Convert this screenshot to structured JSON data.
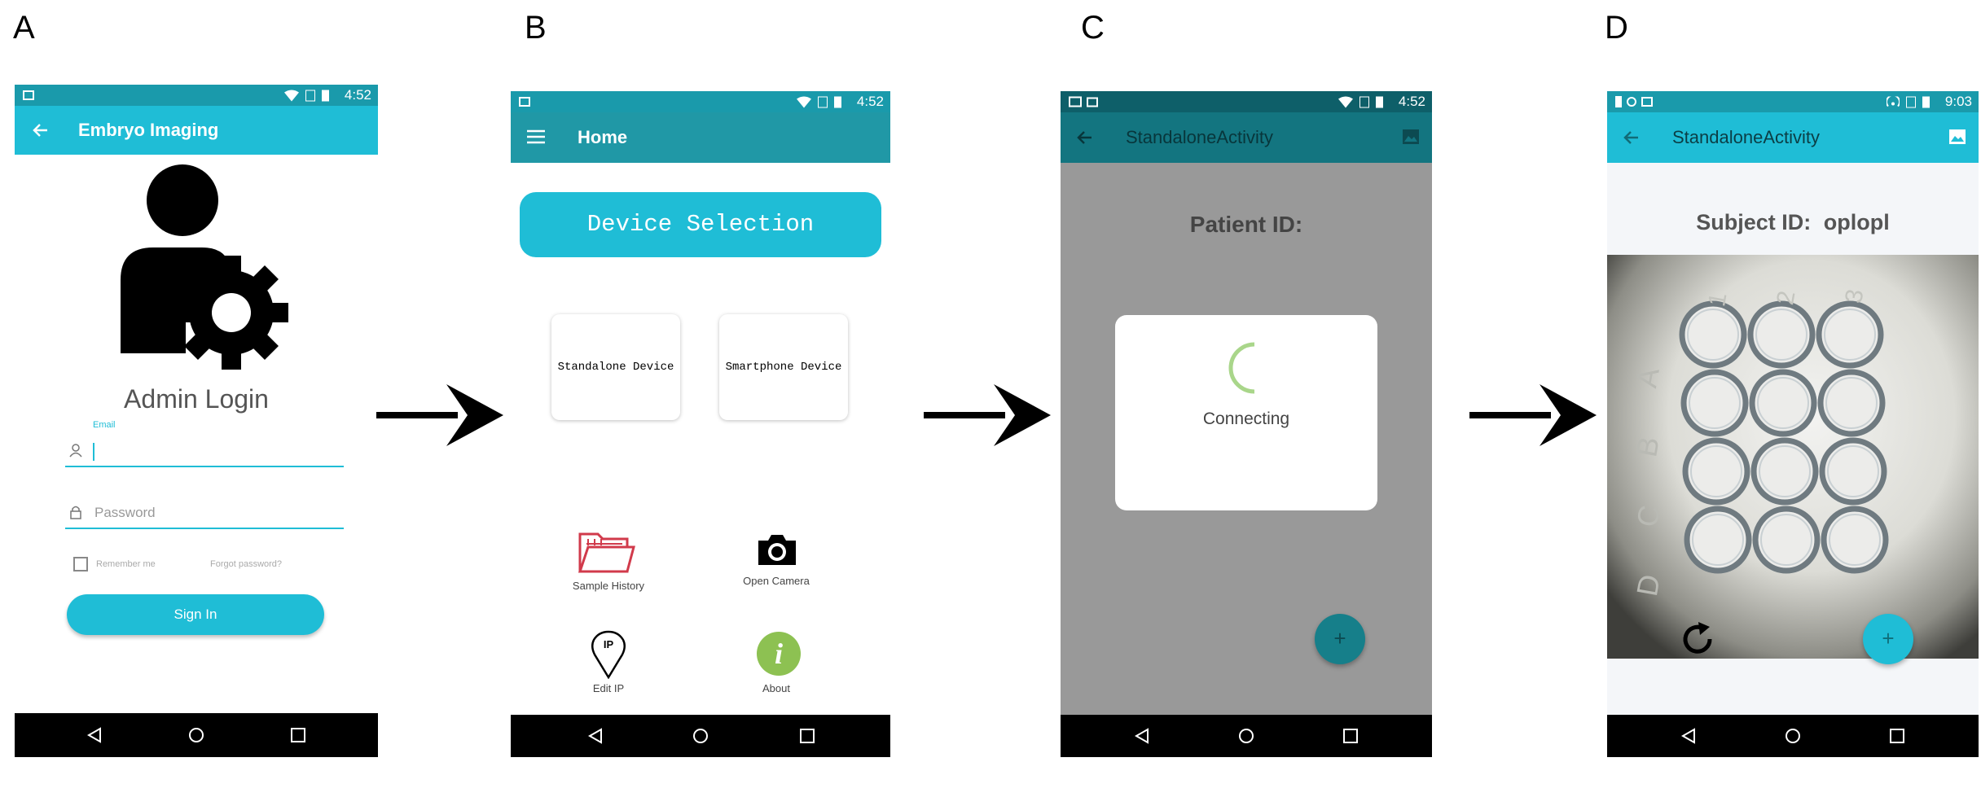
{
  "panels": {
    "a": {
      "letter": "A",
      "status_time": "4:52",
      "appbar_title": "Embryo Imaging",
      "heading": "Admin Login",
      "email_label": "Email",
      "password_placeholder": "Password",
      "remember_label": "Remember me",
      "forgot_label": "Forgot password?",
      "signin_label": "Sign In"
    },
    "b": {
      "letter": "B",
      "status_time": "4:52",
      "appbar_title": "Home",
      "device_selection_label": "Device Selection",
      "standalone_label": "Standalone Device",
      "smartphone_label": "Smartphone Device",
      "sample_history_label": "Sample History",
      "open_camera_label": "Open Camera",
      "edit_ip_label": "Edit IP",
      "about_label": "About",
      "ip_icon_text": "IP",
      "info_icon_text": "i"
    },
    "c": {
      "letter": "C",
      "status_time": "4:52",
      "appbar_title": "StandaloneActivity",
      "patient_id_label": "Patient ID:",
      "connecting_label": "Connecting",
      "fab_label": "+"
    },
    "d": {
      "letter": "D",
      "status_time": "9:03",
      "appbar_title": "StandaloneActivity",
      "subject_id_label": "Subject ID:",
      "subject_id_value": "oplopl",
      "well_rows": [
        "A",
        "B",
        "C",
        "D"
      ],
      "well_cols": [
        "1",
        "2",
        "3"
      ],
      "fab_label": "+"
    }
  },
  "colors": {
    "teal": "#1fbdd6",
    "teal_dark_status": "#1a9aab",
    "teal_home": "#2098a6",
    "dim_status": "#0e5f69",
    "dim_appbar": "#137580",
    "dim_bg": "#999999",
    "fab_dim": "#167f8a",
    "folder_red": "#d13a4b",
    "info_green": "#8dc152",
    "spinner_green": "#a9d68a"
  },
  "icons": {
    "back": "arrow-left-icon",
    "menu": "hamburger-menu-icon",
    "user": "user-icon",
    "lock": "lock-icon",
    "folder": "folder-icon",
    "camera": "camera-icon",
    "location": "location-pin-icon",
    "info": "info-icon",
    "refresh": "refresh-icon",
    "image": "image-icon",
    "admin": "admin-gear-icon"
  }
}
